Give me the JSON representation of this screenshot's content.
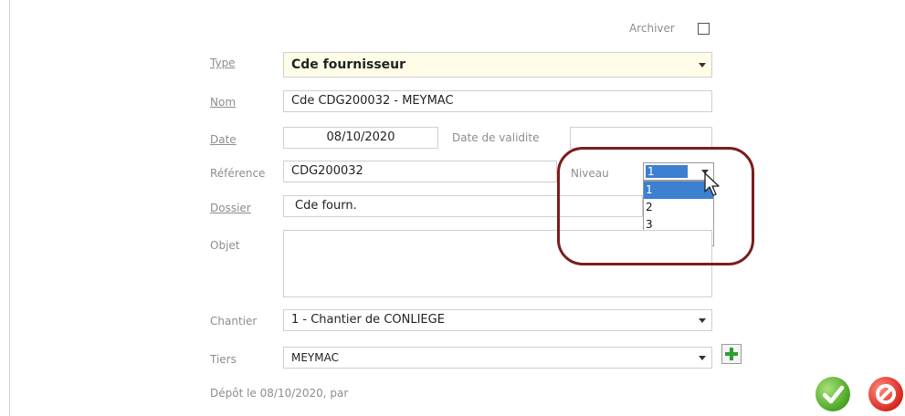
{
  "form": {
    "archiver_label": "Archiver",
    "type": {
      "label": "Type",
      "value": "Cde fournisseur"
    },
    "nom": {
      "label": "Nom",
      "value": "Cde CDG200032 - MEYMAC"
    },
    "date": {
      "label": "Date",
      "value": "08/10/2020"
    },
    "date_validite": {
      "label": "Date de validite",
      "value": ""
    },
    "reference": {
      "label": "Référence",
      "value": "CDG200032"
    },
    "niveau": {
      "label": "Niveau",
      "value": "1",
      "options": [
        "1",
        "2",
        "3"
      ]
    },
    "dossier": {
      "label": "Dossier",
      "value": "Cde fourn."
    },
    "objet": {
      "label": "Objet",
      "value": ""
    },
    "chantier": {
      "label": "Chantier",
      "value": "1 - Chantier de CONLIEGE"
    },
    "tiers": {
      "label": "Tiers",
      "value": "MEYMAC"
    },
    "depot_text": "Dépôt le 08/10/2020, par"
  },
  "colors": {
    "highlight": "#7a1d1d",
    "selection": "#3d7fd1",
    "type_field_bg": "#fffde8",
    "ok_green": "#5cb82e",
    "cancel_red": "#d8281f"
  },
  "icons": [
    "plus-icon",
    "checkmark-icon",
    "cancel-icon",
    "mouse-cursor-icon"
  ]
}
